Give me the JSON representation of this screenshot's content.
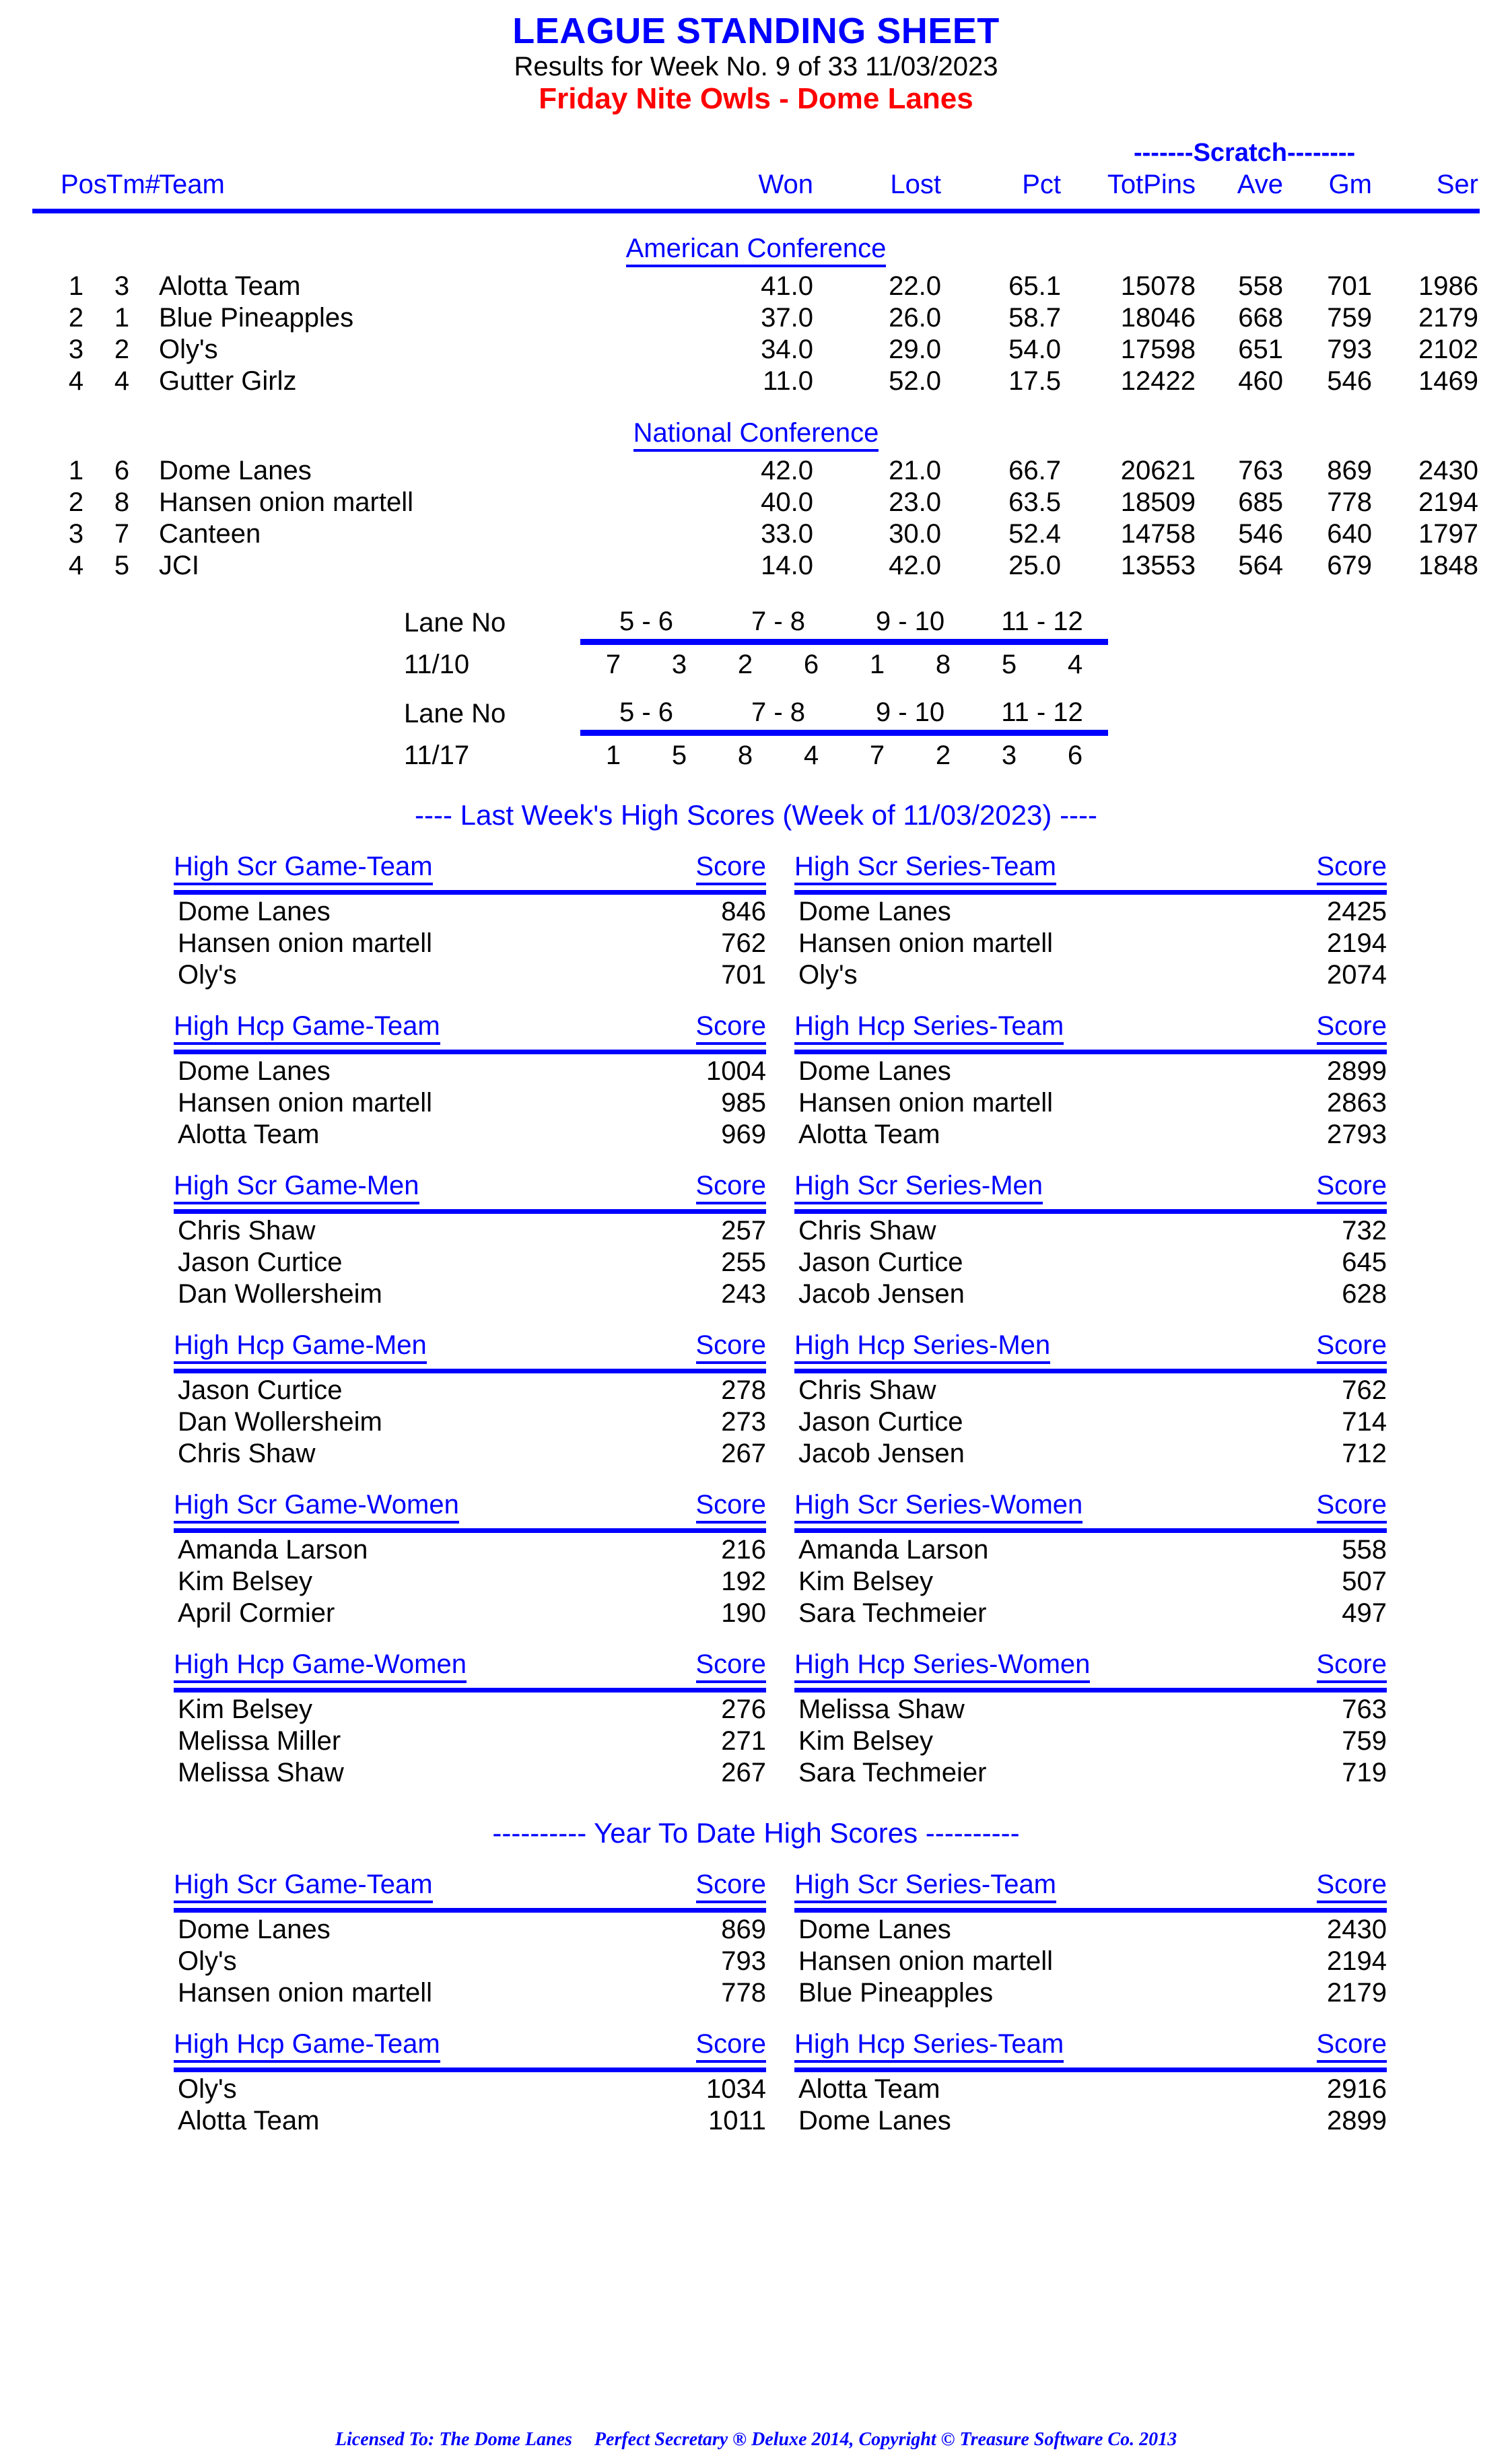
{
  "header": {
    "main_title": "LEAGUE STANDING SHEET",
    "sub_title": "Results for Week No. 9 of 33    11/03/2023",
    "league_title": "Friday Nite Owls - Dome Lanes"
  },
  "standings": {
    "scratch_label": "-------Scratch--------",
    "columns": {
      "pos": "Pos",
      "tm": "Tm#",
      "team": "Team",
      "won": "Won",
      "lost": "Lost",
      "pct": "Pct",
      "totpins": "TotPins",
      "ave": "Ave",
      "gm": "Gm",
      "ser": "Ser"
    },
    "conferences": [
      {
        "name": "American Conference",
        "rows": [
          {
            "pos": "1",
            "tm": "3",
            "team": "Alotta Team",
            "won": "41.0",
            "lost": "22.0",
            "pct": "65.1",
            "totpins": "15078",
            "ave": "558",
            "gm": "701",
            "ser": "1986"
          },
          {
            "pos": "2",
            "tm": "1",
            "team": "Blue Pineapples",
            "won": "37.0",
            "lost": "26.0",
            "pct": "58.7",
            "totpins": "18046",
            "ave": "668",
            "gm": "759",
            "ser": "2179"
          },
          {
            "pos": "3",
            "tm": "2",
            "team": "Oly's",
            "won": "34.0",
            "lost": "29.0",
            "pct": "54.0",
            "totpins": "17598",
            "ave": "651",
            "gm": "793",
            "ser": "2102"
          },
          {
            "pos": "4",
            "tm": "4",
            "team": "Gutter Girlz",
            "won": "11.0",
            "lost": "52.0",
            "pct": "17.5",
            "totpins": "12422",
            "ave": "460",
            "gm": "546",
            "ser": "1469"
          }
        ]
      },
      {
        "name": "National Conference",
        "rows": [
          {
            "pos": "1",
            "tm": "6",
            "team": "Dome Lanes",
            "won": "42.0",
            "lost": "21.0",
            "pct": "66.7",
            "totpins": "20621",
            "ave": "763",
            "gm": "869",
            "ser": "2430"
          },
          {
            "pos": "2",
            "tm": "8",
            "team": "Hansen onion martell",
            "won": "40.0",
            "lost": "23.0",
            "pct": "63.5",
            "totpins": "18509",
            "ave": "685",
            "gm": "778",
            "ser": "2194"
          },
          {
            "pos": "3",
            "tm": "7",
            "team": "Canteen",
            "won": "33.0",
            "lost": "30.0",
            "pct": "52.4",
            "totpins": "14758",
            "ave": "546",
            "gm": "640",
            "ser": "1797"
          },
          {
            "pos": "4",
            "tm": "5",
            "team": "JCI",
            "won": "14.0",
            "lost": "42.0",
            "pct": "25.0",
            "totpins": "13553",
            "ave": "564",
            "gm": "679",
            "ser": "1848"
          }
        ]
      }
    ]
  },
  "lane_schedules": [
    {
      "label": "Lane No",
      "date": "11/10",
      "pairs": [
        "5 -  6",
        "7 - 8",
        "9 - 10",
        "11 - 12"
      ],
      "matchups": [
        [
          "7",
          "3"
        ],
        [
          "2",
          "6"
        ],
        [
          "1",
          "8"
        ],
        [
          "5",
          "4"
        ]
      ]
    },
    {
      "label": "Lane No",
      "date": "11/17",
      "pairs": [
        "5 -  6",
        "7 - 8",
        "9 - 10",
        "11 - 12"
      ],
      "matchups": [
        [
          "1",
          "5"
        ],
        [
          "8",
          "4"
        ],
        [
          "7",
          "2"
        ],
        [
          "3",
          "6"
        ]
      ]
    }
  ],
  "last_week": {
    "banner": "----  Last Week's High Scores   (Week of 11/03/2023)  ----",
    "score_label": "Score",
    "sections": [
      {
        "left": {
          "title": "High Scr Game-Team",
          "rows": [
            {
              "name": "Dome Lanes",
              "score": "846"
            },
            {
              "name": "Hansen onion martell",
              "score": "762"
            },
            {
              "name": "Oly's",
              "score": "701"
            }
          ]
        },
        "right": {
          "title": "High Scr Series-Team",
          "rows": [
            {
              "name": "Dome Lanes",
              "score": "2425"
            },
            {
              "name": "Hansen onion martell",
              "score": "2194"
            },
            {
              "name": "Oly's",
              "score": "2074"
            }
          ]
        }
      },
      {
        "left": {
          "title": "High Hcp Game-Team",
          "rows": [
            {
              "name": "Dome Lanes",
              "score": "1004"
            },
            {
              "name": "Hansen onion martell",
              "score": "985"
            },
            {
              "name": "Alotta Team",
              "score": "969"
            }
          ]
        },
        "right": {
          "title": "High Hcp Series-Team",
          "rows": [
            {
              "name": "Dome Lanes",
              "score": "2899"
            },
            {
              "name": "Hansen onion martell",
              "score": "2863"
            },
            {
              "name": "Alotta Team",
              "score": "2793"
            }
          ]
        }
      },
      {
        "left": {
          "title": "High Scr Game-Men",
          "rows": [
            {
              "name": "Chris Shaw",
              "score": "257"
            },
            {
              "name": "Jason Curtice",
              "score": "255"
            },
            {
              "name": "Dan Wollersheim",
              "score": "243"
            }
          ]
        },
        "right": {
          "title": "High Scr Series-Men",
          "rows": [
            {
              "name": "Chris Shaw",
              "score": "732"
            },
            {
              "name": "Jason Curtice",
              "score": "645"
            },
            {
              "name": "Jacob Jensen",
              "score": "628"
            }
          ]
        }
      },
      {
        "left": {
          "title": "High Hcp Game-Men",
          "rows": [
            {
              "name": "Jason Curtice",
              "score": "278"
            },
            {
              "name": "Dan Wollersheim",
              "score": "273"
            },
            {
              "name": "Chris Shaw",
              "score": "267"
            }
          ]
        },
        "right": {
          "title": "High Hcp Series-Men",
          "rows": [
            {
              "name": "Chris Shaw",
              "score": "762"
            },
            {
              "name": "Jason Curtice",
              "score": "714"
            },
            {
              "name": "Jacob Jensen",
              "score": "712"
            }
          ]
        }
      },
      {
        "left": {
          "title": "High Scr Game-Women",
          "rows": [
            {
              "name": "Amanda Larson",
              "score": "216"
            },
            {
              "name": "Kim Belsey",
              "score": "192"
            },
            {
              "name": "April Cormier",
              "score": "190"
            }
          ]
        },
        "right": {
          "title": "High Scr Series-Women",
          "rows": [
            {
              "name": "Amanda Larson",
              "score": "558"
            },
            {
              "name": "Kim Belsey",
              "score": "507"
            },
            {
              "name": "Sara Techmeier",
              "score": "497"
            }
          ]
        }
      },
      {
        "left": {
          "title": "High Hcp Game-Women",
          "rows": [
            {
              "name": "Kim Belsey",
              "score": "276"
            },
            {
              "name": "Melissa Miller",
              "score": "271"
            },
            {
              "name": "Melissa Shaw",
              "score": "267"
            }
          ]
        },
        "right": {
          "title": "High Hcp Series-Women",
          "rows": [
            {
              "name": "Melissa Shaw",
              "score": "763"
            },
            {
              "name": "Kim Belsey",
              "score": "759"
            },
            {
              "name": "Sara Techmeier",
              "score": "719"
            }
          ]
        }
      }
    ]
  },
  "year_to_date": {
    "banner": "---------- Year To Date High Scores ----------",
    "score_label": "Score",
    "sections": [
      {
        "left": {
          "title": "High Scr Game-Team",
          "rows": [
            {
              "name": "Dome Lanes",
              "score": "869"
            },
            {
              "name": "Oly's",
              "score": "793"
            },
            {
              "name": "Hansen onion martell",
              "score": "778"
            }
          ]
        },
        "right": {
          "title": "High Scr Series-Team",
          "rows": [
            {
              "name": "Dome Lanes",
              "score": "2430"
            },
            {
              "name": "Hansen onion martell",
              "score": "2194"
            },
            {
              "name": "Blue Pineapples",
              "score": "2179"
            }
          ]
        }
      },
      {
        "left": {
          "title": "High Hcp Game-Team",
          "rows": [
            {
              "name": "Oly's",
              "score": "1034"
            },
            {
              "name": "Alotta Team",
              "score": "1011"
            }
          ]
        },
        "right": {
          "title": "High Hcp Series-Team",
          "rows": [
            {
              "name": "Alotta Team",
              "score": "2916"
            },
            {
              "name": "Dome Lanes",
              "score": "2899"
            }
          ]
        }
      }
    ]
  },
  "footer": {
    "licensed_to": "Licensed To: The Dome Lanes",
    "copyright": "Perfect Secretary ® Deluxe  2014, Copyright © Treasure Software Co. 2013"
  }
}
